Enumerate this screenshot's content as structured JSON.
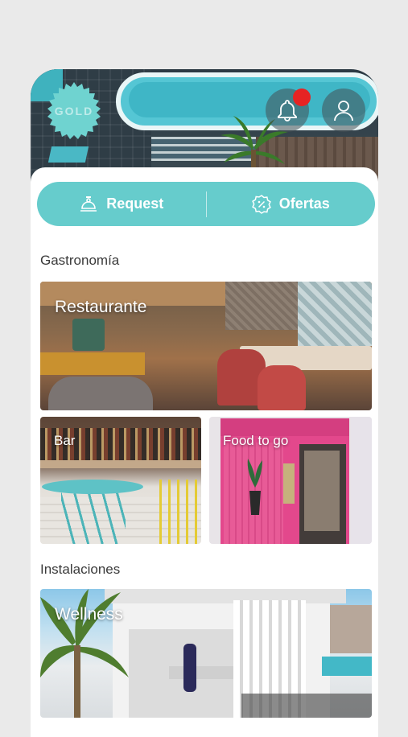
{
  "header": {
    "badge_text": "GOLD",
    "bell_icon": "bell-icon",
    "profile_icon": "user-icon",
    "notification_dot_color": "#e62323"
  },
  "tabs": [
    {
      "label": "Request",
      "icon": "room-service-icon"
    },
    {
      "label": "Ofertas",
      "icon": "discount-badge-icon"
    }
  ],
  "sections": {
    "gastronomia": {
      "title": "Gastronomía",
      "cards": [
        {
          "label": "Restaurante"
        },
        {
          "label": "Bar"
        },
        {
          "label": "Food to go"
        }
      ]
    },
    "instalaciones": {
      "title": "Instalaciones",
      "cards": [
        {
          "label": "Wellness"
        }
      ]
    }
  },
  "colors": {
    "accent": "#66cccc",
    "background": "#eaeaea"
  }
}
